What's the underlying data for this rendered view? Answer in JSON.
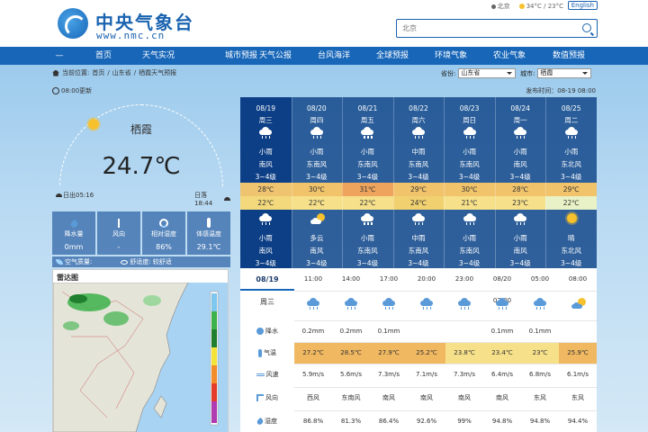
{
  "header": {
    "logo_text": "中央气象台",
    "logo_url": "www.nmc.cn",
    "top_links": [
      "北京",
      "34°C / 23°C"
    ],
    "english_label": "English",
    "search_placeholder": "北京"
  },
  "nav": [
    "首页",
    "天气实况",
    "城市预报",
    "天气公报",
    "台风海洋",
    "全球预报",
    "环境气象",
    "农业气象",
    "数值预报"
  ],
  "breadcrumb": [
    "当前位置:",
    "首页",
    "/",
    "山东省",
    "/",
    "栖霞天气预报"
  ],
  "selectors": {
    "province_label": "省份:",
    "province_value": "山东省",
    "city_label": "城市:",
    "city_value": "栖霞"
  },
  "updated_label": "08:00更新",
  "publish_time": "发布时间：08-19 08:00",
  "current": {
    "city": "栖霞",
    "temperature": "24.7℃",
    "sunrise": "日出05:16",
    "sunset": "日落18:44"
  },
  "stats": [
    {
      "icon": "rain-gauge-icon",
      "label": "降水量",
      "value": "0mm"
    },
    {
      "icon": "wind-vane-icon",
      "label": "风向",
      "value": "-"
    },
    {
      "icon": "humidity-icon",
      "label": "相对湿度",
      "value": "86%"
    },
    {
      "icon": "thermometer-icon",
      "label": "体感温度",
      "value": "29.1℃"
    }
  ],
  "air_quality": {
    "label": "空气质量:",
    "comfort_label": "舒适度:",
    "comfort_value": "较舒适"
  },
  "radar": {
    "title": "雷达图"
  },
  "forecast": [
    {
      "date": "08/19",
      "weekday": "周三",
      "day_icon": "rain-icon",
      "day_desc": "小雨",
      "day_wind": "南风",
      "day_level": "3~4级",
      "high": "28℃",
      "low": "22℃",
      "night_icon": "rain-icon",
      "night_desc": "小雨",
      "night_wind": "南风",
      "night_level": "3~4级"
    },
    {
      "date": "08/20",
      "weekday": "周四",
      "day_icon": "rain-icon",
      "day_desc": "小雨",
      "day_wind": "东南风",
      "day_level": "3~4级",
      "high": "30℃",
      "low": "22℃",
      "night_icon": "partly-cloudy-icon",
      "night_desc": "多云",
      "night_wind": "南风",
      "night_level": "3~4级"
    },
    {
      "date": "08/21",
      "weekday": "周五",
      "day_icon": "rain-icon",
      "day_desc": "小雨",
      "day_wind": "东南风",
      "day_level": "3~4级",
      "high": "31℃",
      "low": "22℃",
      "night_icon": "rain-icon",
      "night_desc": "小雨",
      "night_wind": "东南风",
      "night_level": "3~4级"
    },
    {
      "date": "08/22",
      "weekday": "周六",
      "day_icon": "rain-icon",
      "day_desc": "中雨",
      "day_wind": "东南风",
      "day_level": "3~4级",
      "high": "29℃",
      "low": "24℃",
      "night_icon": "rain-icon",
      "night_desc": "中雨",
      "night_wind": "东南风",
      "night_level": "3~4级"
    },
    {
      "date": "08/23",
      "weekday": "周日",
      "day_icon": "rain-icon",
      "day_desc": "小雨",
      "day_wind": "东南风",
      "day_level": "3~4级",
      "high": "30℃",
      "low": "21℃",
      "night_icon": "rain-icon",
      "night_desc": "小雨",
      "night_wind": "东南风",
      "night_level": "3~4级"
    },
    {
      "date": "08/24",
      "weekday": "周一",
      "day_icon": "rain-icon",
      "day_desc": "小雨",
      "day_wind": "南风",
      "day_level": "3~4级",
      "high": "28℃",
      "low": "23℃",
      "night_icon": "rain-icon",
      "night_desc": "小雨",
      "night_wind": "南风",
      "night_level": "3~4级"
    },
    {
      "date": "08/25",
      "weekday": "周二",
      "day_icon": "rain-icon",
      "day_desc": "小雨",
      "day_wind": "东北风",
      "day_level": "3~4级",
      "high": "29℃",
      "low": "22℃",
      "night_icon": "sunny-icon",
      "night_desc": "晴",
      "night_wind": "东北风",
      "night_level": "3~4级"
    }
  ],
  "hourly": {
    "date": "08/19",
    "weekday": "周三",
    "times": [
      "11:00",
      "14:00",
      "17:00",
      "20:00",
      "23:00",
      "08/20 02:00",
      "05:00",
      "08:00"
    ],
    "icons": [
      "rain-icon",
      "rain-icon",
      "rain-icon",
      "rain-icon",
      "rain-icon",
      "rain-icon",
      "rain-icon",
      "partly-cloudy-icon"
    ],
    "row_labels": [
      "降水",
      "气温",
      "风速",
      "风向",
      "湿度"
    ],
    "precip": [
      "0.2mm",
      "0.2mm",
      "0.1mm",
      "",
      "",
      "0.1mm",
      "0.1mm",
      ""
    ],
    "temp": [
      "27.2℃",
      "28.5℃",
      "27.9℃",
      "25.2℃",
      "23.8℃",
      "23.4℃",
      "23℃",
      "25.9℃"
    ],
    "wind_speed": [
      "5.9m/s",
      "5.6m/s",
      "7.3m/s",
      "7.1m/s",
      "7.3m/s",
      "6.4m/s",
      "6.8m/s",
      "6.1m/s"
    ],
    "wind_dir": [
      "西风",
      "东南风",
      "南风",
      "南风",
      "南风",
      "南风",
      "东风",
      "东风"
    ],
    "humidity": [
      "86.8%",
      "81.3%",
      "86.4%",
      "92.6%",
      "99%",
      "94.8%",
      "94.8%",
      "94.4%"
    ]
  },
  "colors": {
    "brand": "#1766b8",
    "nav_bg": "#1766b8",
    "forecast_bg": "#0a3f86",
    "high_temp_bg": "#f1c36b",
    "low_temp_bg": "#f6e08a",
    "temp_row_bg": "#f0b860"
  }
}
